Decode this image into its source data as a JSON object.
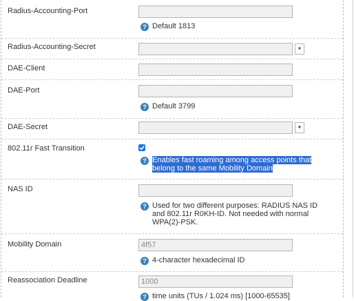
{
  "fields": {
    "radius_accounting_port": {
      "label": "Radius-Accounting-Port",
      "value": "",
      "help": "Default 1813"
    },
    "radius_accounting_secret": {
      "label": "Radius-Accounting-Secret",
      "value": "",
      "reveal": "*"
    },
    "dae_client": {
      "label": "DAE-Client",
      "value": ""
    },
    "dae_port": {
      "label": "DAE-Port",
      "value": "",
      "help": "Default 3799"
    },
    "dae_secret": {
      "label": "DAE-Secret",
      "value": "",
      "reveal": "*"
    },
    "fast_transition": {
      "label": "802.11r Fast Transition",
      "checked": true,
      "help_line1": "Enables fast roaming among access points that",
      "help_line2": "belong to the same Mobility Domain"
    },
    "nas_id": {
      "label": "NAS ID",
      "value": "",
      "help_line1": "Used for two different purposes: RADIUS NAS ID",
      "help_line2": "and 802.11r R0KH-ID. Not needed with normal",
      "help_line3": "WPA(2)-PSK."
    },
    "mobility_domain": {
      "label": "Mobility Domain",
      "value": "4f57",
      "help": "4-character hexadecimal ID"
    },
    "reassociation_deadline": {
      "label": "Reassociation Deadline",
      "value": "1000",
      "help": "time units (TUs / 1.024 ms) [1000-65535]"
    }
  },
  "icons": {
    "help": "help-icon",
    "reveal": "reveal-password-icon",
    "check": "checkmark-icon"
  },
  "colors": {
    "help_icon": "#3a81b8",
    "selection": "#2e6bd2",
    "checkbox": "#1a73e8"
  }
}
